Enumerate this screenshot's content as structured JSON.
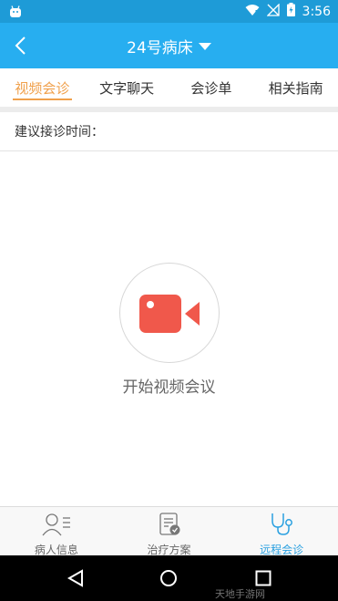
{
  "status_bar": {
    "time": "3:56"
  },
  "nav": {
    "title": "24号病床"
  },
  "tabs": [
    {
      "label": "视频会诊",
      "active": true
    },
    {
      "label": "文字聊天",
      "active": false
    },
    {
      "label": "会诊单",
      "active": false
    },
    {
      "label": "相关指南",
      "active": false
    }
  ],
  "consult": {
    "suggest_time_label": "建议接诊时间：",
    "start_video_label": "开始视频会议"
  },
  "bottom_nav": [
    {
      "label": "病人信息",
      "icon": "patient-info-icon",
      "active": false
    },
    {
      "label": "治疗方案",
      "icon": "treatment-plan-icon",
      "active": false
    },
    {
      "label": "远程会诊",
      "icon": "stethoscope-icon",
      "active": true
    }
  ],
  "watermark": "天地手游网",
  "colors": {
    "status_bar": "#1e9bd7",
    "nav_bar": "#27aef0",
    "tab_active": "#f0a04b",
    "video_icon": "#f0584b",
    "bottom_active": "#2aa0e0"
  }
}
